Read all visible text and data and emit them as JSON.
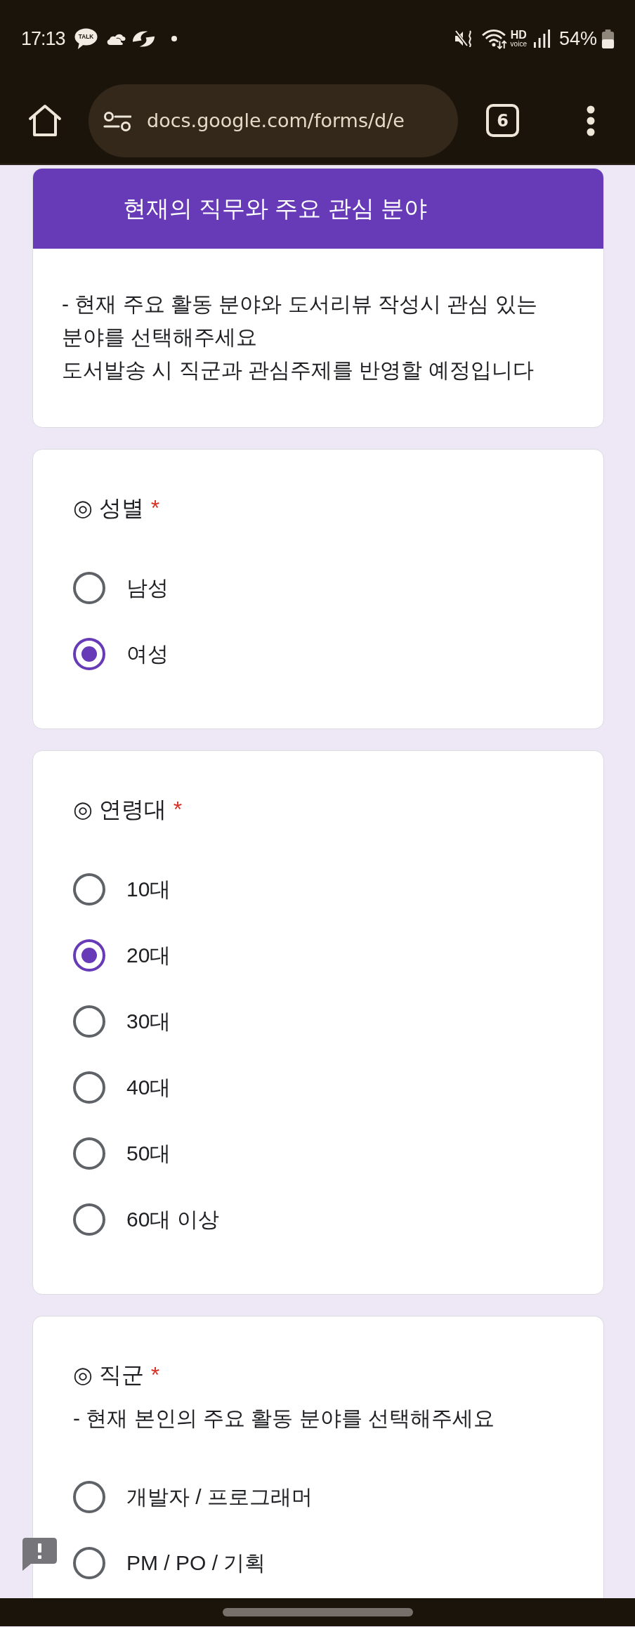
{
  "status_bar": {
    "time": "17:13",
    "notifications": [
      {
        "kind": "chat",
        "label": "TALK"
      },
      {
        "kind": "cloud"
      },
      {
        "kind": "swirl"
      },
      {
        "kind": "dot"
      }
    ],
    "indicators": [
      {
        "kind": "mute"
      },
      {
        "kind": "wifi"
      },
      {
        "kind": "hd_voice",
        "lines": [
          "HD",
          "voice"
        ]
      },
      {
        "kind": "signal"
      }
    ],
    "battery": "54%"
  },
  "browser_toolbar": {
    "url": "docs.google.com/forms/d/e",
    "tab_count": "6"
  },
  "section_header": {
    "title": "현재의 직무와 주요 관심 분야",
    "description": [
      "- 현재 주요 활동 분야와 도서리뷰 작성시 관심 있는 분야를 선택해주세요",
      "도서발송 시 직군과 관심주제를 반영할 예정입니다"
    ]
  },
  "questions": [
    {
      "title": "◎ 성별",
      "required_mark": "*",
      "options": [
        {
          "label": "남성",
          "selected": false
        },
        {
          "label": "여성",
          "selected": true
        }
      ]
    },
    {
      "title": "◎ 연령대",
      "required_mark": "*",
      "options": [
        {
          "label": "10대",
          "selected": false
        },
        {
          "label": "20대",
          "selected": true
        },
        {
          "label": "30대",
          "selected": false
        },
        {
          "label": "40대",
          "selected": false
        },
        {
          "label": "50대",
          "selected": false
        },
        {
          "label": "60대 이상",
          "selected": false
        }
      ]
    },
    {
      "title": "◎ 직군",
      "required_mark": "*",
      "description": "- 현재 본인의 주요 활동 분야를 선택해주세요",
      "options": [
        {
          "label": "개발자 / 프로그래머",
          "selected": false
        },
        {
          "label": "PM / PO / 기획",
          "selected": false
        }
      ]
    }
  ]
}
